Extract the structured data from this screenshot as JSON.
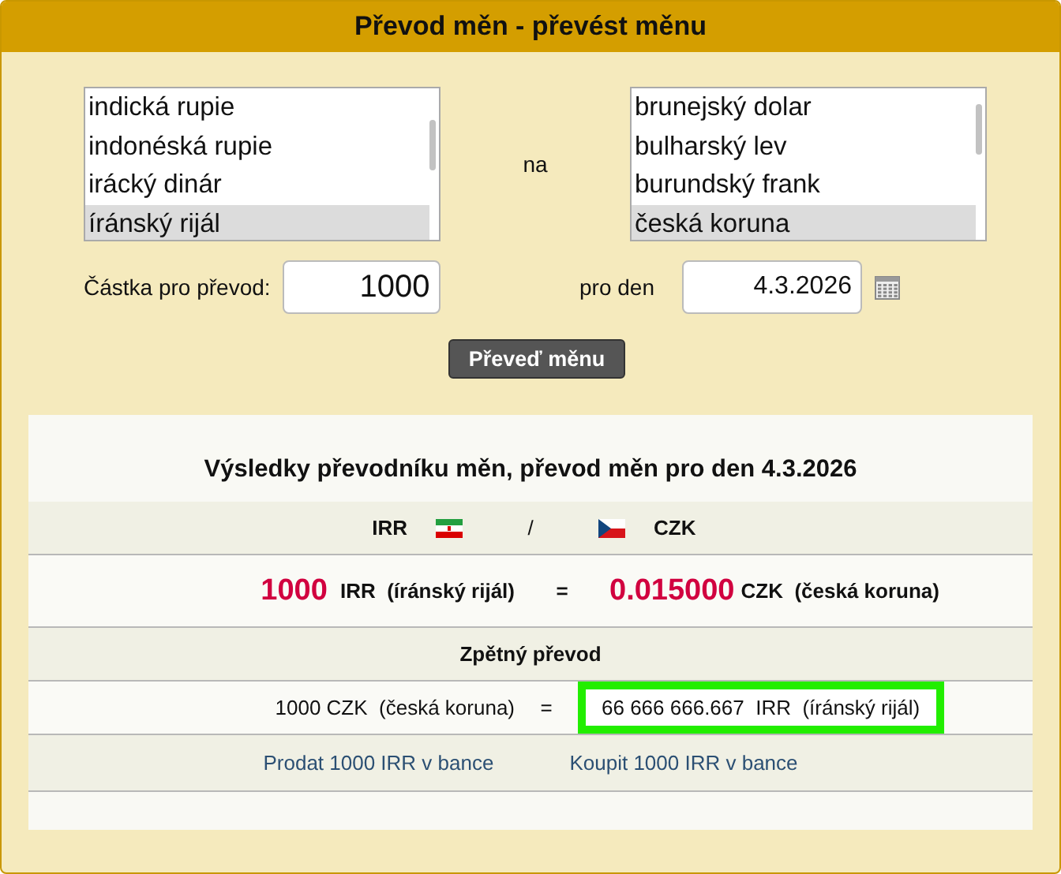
{
  "window": {
    "title": "Převod měn - převést měnu"
  },
  "from_list": {
    "items": [
      {
        "label": "indická rupie",
        "selected": false
      },
      {
        "label": "indonéská rupie",
        "selected": false
      },
      {
        "label": "irácký dinár",
        "selected": false
      },
      {
        "label": "íránský rijál",
        "selected": true
      }
    ]
  },
  "connector": "na",
  "to_list": {
    "items": [
      {
        "label": "brunejský dolar",
        "selected": false
      },
      {
        "label": "bulharský lev",
        "selected": false
      },
      {
        "label": "burundský frank",
        "selected": false
      },
      {
        "label": "česká koruna",
        "selected": true
      }
    ]
  },
  "amount": {
    "label": "Částka pro převod:",
    "value": "1000"
  },
  "date": {
    "label": "pro den",
    "value": "4.3.2026"
  },
  "convert_button": "Převeď měnu",
  "results": {
    "title": "Výsledky převodníku měn, převod měn pro den 4.3.2026",
    "pair": {
      "from_code": "IRR",
      "separator": "/",
      "to_code": "CZK"
    },
    "main": {
      "amount": "1000",
      "from_code": "IRR",
      "from_name": "(íránský rijál)",
      "equals": "=",
      "result": "0.015000",
      "to_code": "CZK",
      "to_name": "(česká koruna)"
    },
    "reverse": {
      "title": "Zpětný převod",
      "left": "1000 CZK  (česká koruna)",
      "equals": "=",
      "right": "66 666 666.667  IRR  (íránský rijál)",
      "highlighted": true
    },
    "links": [
      "Prodat 1000 IRR v bance",
      "Koupit 1000 IRR v bance"
    ]
  }
}
